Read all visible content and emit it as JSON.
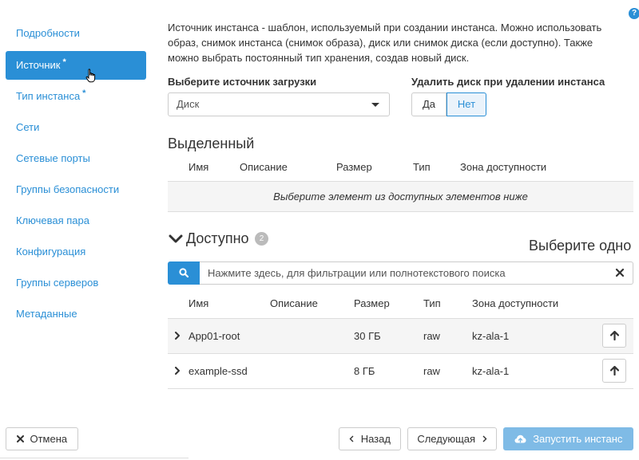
{
  "sidebar": {
    "items": [
      {
        "label": "Подробности",
        "required": ""
      },
      {
        "label": "Источник",
        "required": "*"
      },
      {
        "label": "Тип инстанса",
        "required": "*"
      },
      {
        "label": "Сети",
        "required": ""
      },
      {
        "label": "Сетевые порты",
        "required": ""
      },
      {
        "label": "Группы безопасности",
        "required": ""
      },
      {
        "label": "Ключевая пара",
        "required": ""
      },
      {
        "label": "Конфигурация",
        "required": ""
      },
      {
        "label": "Группы серверов",
        "required": ""
      },
      {
        "label": "Метаданные",
        "required": ""
      }
    ],
    "active_index": 1
  },
  "help_icon": "?",
  "description": "Источник инстанса - шаблон, используемый при создании инстанса. Можно использовать образ, снимок инстанса (снимок образа), диск или снимок диска (если доступно). Также можно выбрать постоянный тип хранения, создав новый диск.",
  "boot_source": {
    "label": "Выберите источник загрузки",
    "value": "Диск"
  },
  "delete_volume": {
    "label": "Удалить диск при удалении инстанса",
    "yes": "Да",
    "no": "Нет",
    "selected": "Нет"
  },
  "allocated": {
    "title": "Выделенный",
    "columns": [
      "Имя",
      "Описание",
      "Размер",
      "Тип",
      "Зона доступности"
    ],
    "empty_text": "Выберите элемент из доступных элементов ниже"
  },
  "available": {
    "title": "Доступно",
    "count": "2",
    "choose_text": "Выберите одно",
    "search_placeholder": "Нажмите здесь, для фильтрации или полнотекстового поиска",
    "columns": [
      "Имя",
      "Описание",
      "Размер",
      "Тип",
      "Зона доступности"
    ],
    "rows": [
      {
        "name": "App01-root",
        "description": "",
        "size": "30 ГБ",
        "type": "raw",
        "zone": "kz-ala-1"
      },
      {
        "name": "example-ssd",
        "description": "",
        "size": "8 ГБ",
        "type": "raw",
        "zone": "kz-ala-1"
      }
    ]
  },
  "footer": {
    "cancel": "Отмена",
    "back": "Назад",
    "next": "Следующая",
    "launch": "Запустить инстанс"
  },
  "colors": {
    "accent": "#2a8fd6",
    "launch_disabled": "#7fbbe6",
    "row_shade": "#f5f5f5"
  }
}
